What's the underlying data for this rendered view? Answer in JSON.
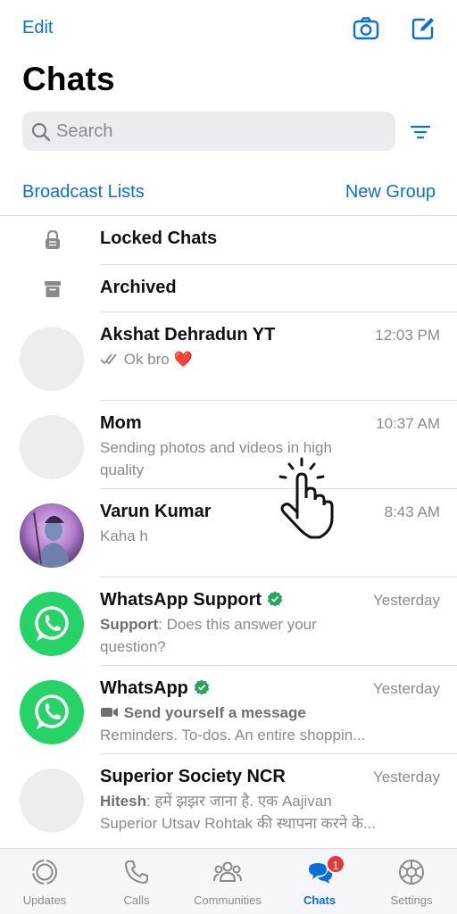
{
  "header": {
    "edit_label": "Edit",
    "title": "Chats",
    "camera_icon": "camera-icon",
    "compose_icon": "compose-icon"
  },
  "search": {
    "placeholder": "Search",
    "filter_icon": "filter-icon"
  },
  "links": {
    "broadcast": "Broadcast Lists",
    "new_group": "New Group"
  },
  "special_rows": [
    {
      "label": "Locked Chats",
      "icon": "lock-icon"
    },
    {
      "label": "Archived",
      "icon": "archive-icon"
    }
  ],
  "chats": [
    {
      "name": "Akshat Dehradun YT",
      "time": "12:03 PM",
      "message": "Ok bro",
      "ticks": "double-check",
      "emoji": "❤️"
    },
    {
      "name": "Mom",
      "time": "10:37 AM",
      "message": "Sending photos and videos in high quality"
    },
    {
      "name": "Varun Kumar",
      "time": "8:43 AM",
      "message": "Kaha h"
    },
    {
      "name": "WhatsApp Support",
      "time": "Yesterday",
      "sender": "Support",
      "message": ": Does this answer your question?"
    },
    {
      "name": "WhatsApp",
      "time": "Yesterday",
      "message_bold": "Send yourself a message",
      "message": "Reminders. To-dos. An entire shoppin..."
    },
    {
      "name": "Superior Society NCR",
      "time": "Yesterday",
      "sender": "Hitesh",
      "message": ": हमें झझर जाना है. एक Aajivan",
      "message2": "Superior Utsav Rohtak की स्थापना करने के..."
    }
  ],
  "tabs": [
    {
      "label": "Updates",
      "icon": "updates-icon"
    },
    {
      "label": "Calls",
      "icon": "phone-icon"
    },
    {
      "label": "Communities",
      "icon": "communities-icon"
    },
    {
      "label": "Chats",
      "icon": "chats-icon",
      "badge": "1",
      "active": true
    },
    {
      "label": "Settings",
      "icon": "gear-icon"
    }
  ],
  "colors": {
    "accent": "#0a6fd6",
    "whatsapp_green": "#25d366",
    "verified_green": "#25a45a",
    "badge_red": "#e53935"
  }
}
